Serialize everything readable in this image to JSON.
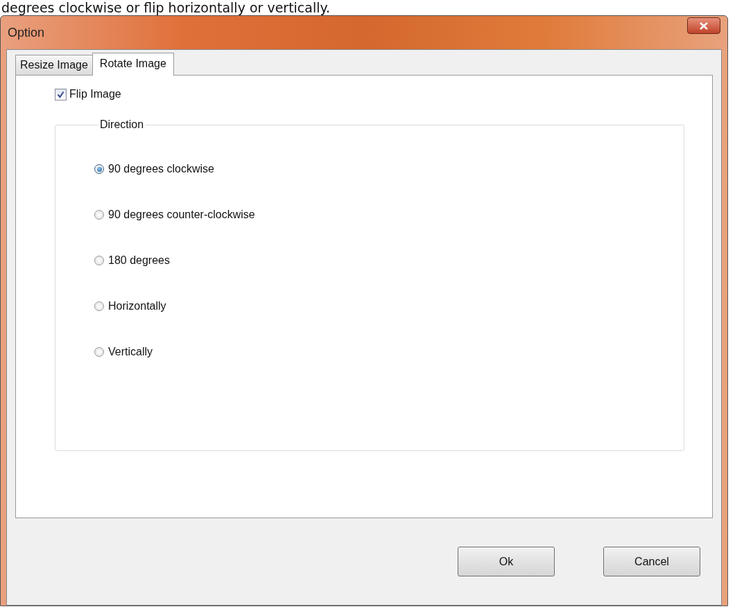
{
  "caption": "degrees clockwise or flip horizontally or vertically.",
  "window": {
    "title": "Option"
  },
  "tabs": [
    {
      "label": "Resize Image",
      "selected": false
    },
    {
      "label": "Rotate Image",
      "selected": true
    }
  ],
  "flip_image": {
    "label": "Flip Image",
    "checked": true
  },
  "direction": {
    "legend": "Direction",
    "options": [
      {
        "label": "90 degrees clockwise",
        "selected": true
      },
      {
        "label": "90 degrees counter-clockwise",
        "selected": false
      },
      {
        "label": "180 degrees",
        "selected": false
      },
      {
        "label": "Horizontally",
        "selected": false
      },
      {
        "label": "Vertically",
        "selected": false
      }
    ]
  },
  "buttons": [
    "Ok",
    "Cancel"
  ]
}
